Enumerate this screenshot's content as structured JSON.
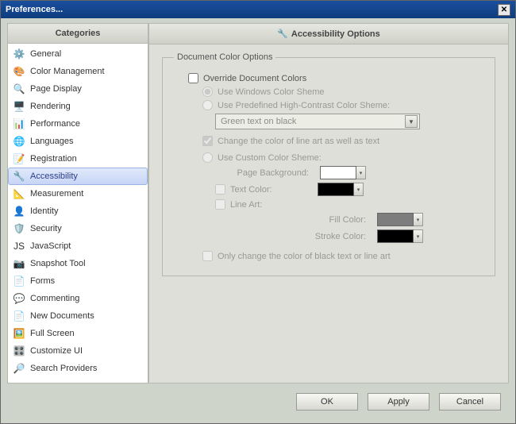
{
  "title": "Preferences...",
  "sidebar": {
    "header": "Categories",
    "items": [
      {
        "label": "General",
        "icon": "⚙️"
      },
      {
        "label": "Color Management",
        "icon": "🎨"
      },
      {
        "label": "Page Display",
        "icon": "🔍"
      },
      {
        "label": "Rendering",
        "icon": "🖥️"
      },
      {
        "label": "Performance",
        "icon": "📊"
      },
      {
        "label": "Languages",
        "icon": "🌐"
      },
      {
        "label": "Registration",
        "icon": "📝"
      },
      {
        "label": "Accessibility",
        "icon": "🔧",
        "selected": true
      },
      {
        "label": "Measurement",
        "icon": "📐"
      },
      {
        "label": "Identity",
        "icon": "👤"
      },
      {
        "label": "Security",
        "icon": "🛡️"
      },
      {
        "label": "JavaScript",
        "icon": "JS"
      },
      {
        "label": "Snapshot Tool",
        "icon": "📷"
      },
      {
        "label": "Forms",
        "icon": "📄"
      },
      {
        "label": "Commenting",
        "icon": "💬"
      },
      {
        "label": "New Documents",
        "icon": "📄"
      },
      {
        "label": "Full Screen",
        "icon": "🖼️"
      },
      {
        "label": "Customize UI",
        "icon": "🎛️"
      },
      {
        "label": "Search Providers",
        "icon": "🔎"
      }
    ]
  },
  "panel": {
    "header": "Accessibility Options",
    "groupbox": "Document Color Options",
    "override": "Override Document Colors",
    "useWindows": "Use Windows Color Sheme",
    "usePredef": "Use Predefined High-Contrast Color Sheme:",
    "predefValue": "Green text on black",
    "changeLineArt": "Change the color of line art as well as text",
    "useCustom": "Use Custom Color Sheme:",
    "pageBg": "Page Background:",
    "textColor": "Text Color:",
    "lineArt": "Line Art:",
    "fillColor": "Fill Color:",
    "strokeColor": "Stroke Color:",
    "onlyBlack": "Only change the color of black text or line art",
    "swatches": {
      "pageBg": "#ffffff",
      "textColor": "#000000",
      "fill": "#7d7d7d",
      "stroke": "#000000"
    }
  },
  "buttons": {
    "ok": "OK",
    "apply": "Apply",
    "cancel": "Cancel"
  }
}
